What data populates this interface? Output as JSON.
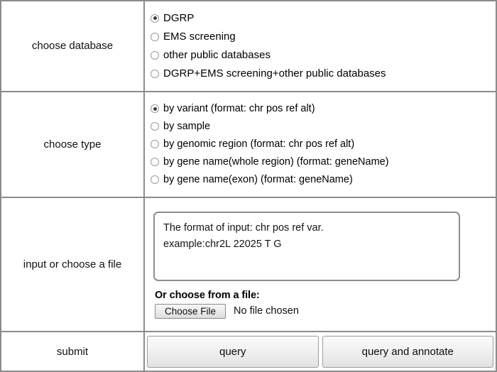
{
  "rows": {
    "database": {
      "label": "choose database",
      "options": [
        {
          "label": "DGRP",
          "selected": true
        },
        {
          "label": "EMS screening",
          "selected": false
        },
        {
          "label": "other public databases",
          "selected": false
        },
        {
          "label": "DGRP+EMS screening+other public databases",
          "selected": false
        }
      ]
    },
    "type": {
      "label": "choose type",
      "options": [
        {
          "label": "by variant (format: chr pos ref alt)",
          "selected": true
        },
        {
          "label": "by sample",
          "selected": false
        },
        {
          "label": "by genomic region (format: chr pos ref alt)",
          "selected": false
        },
        {
          "label": "by gene name(whole region) (format: geneName)",
          "selected": false
        },
        {
          "label": "by gene name(exon) (format: geneName)",
          "selected": false
        }
      ]
    },
    "input": {
      "label": "input or choose a file",
      "textarea_line1": "The format of input: chr pos ref var.",
      "textarea_line2": "example:chr2L 22025 T G",
      "textarea_value": "The format of input: chr pos ref var.\nexample:chr2L 22025 T G",
      "file_section_label": "Or choose from a file:",
      "choose_file_button": "Choose File",
      "file_status": "No file chosen"
    },
    "submit": {
      "label": "submit",
      "buttons": [
        {
          "label": "query"
        },
        {
          "label": "query and annotate"
        }
      ]
    }
  },
  "colors": {
    "border": "#8c8c8c",
    "radio_border": "#9a9a9a",
    "radio_dot": "#3a3a3a",
    "button_face": "#ededed",
    "background": "#ffffff",
    "text": "#000000"
  }
}
